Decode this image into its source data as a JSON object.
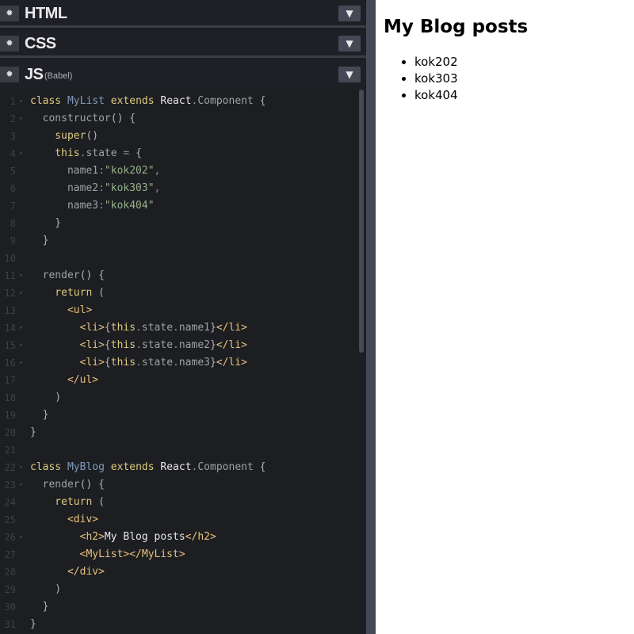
{
  "panels": {
    "html": {
      "title": "HTML",
      "sub": ""
    },
    "css": {
      "title": "CSS",
      "sub": ""
    },
    "js": {
      "title": "JS",
      "sub": "(Babel)"
    }
  },
  "icons": {
    "gear": "gear-icon",
    "chevron": "chevron-down-icon"
  },
  "colors": {
    "editor_bg": "#1d1e22",
    "header_bg": "#1f2026",
    "resizer": "#444857",
    "keyword": "#ddca7e",
    "class_name": "#809bbd",
    "string": "#96b38a",
    "tag": "#e6c07b"
  },
  "code": [
    {
      "n": "1",
      "fold": true,
      "tokens": [
        [
          "kw",
          "class "
        ],
        [
          "cls",
          "MyList "
        ],
        [
          "kw",
          "extends "
        ],
        [
          "txt",
          "React"
        ],
        [
          "pun",
          "."
        ],
        [
          "pl",
          "Component "
        ],
        [
          "br",
          "{"
        ]
      ]
    },
    {
      "n": "2",
      "fold": true,
      "tokens": [
        [
          "pl",
          "  constructor"
        ],
        [
          "br",
          "() {"
        ]
      ]
    },
    {
      "n": "3",
      "fold": false,
      "tokens": [
        [
          "kw",
          "    super"
        ],
        [
          "br",
          "()"
        ]
      ]
    },
    {
      "n": "4",
      "fold": true,
      "tokens": [
        [
          "kw",
          "    this"
        ],
        [
          "pun",
          "."
        ],
        [
          "pl",
          "state "
        ],
        [
          "pun",
          "= "
        ],
        [
          "br",
          "{"
        ]
      ]
    },
    {
      "n": "5",
      "fold": false,
      "tokens": [
        [
          "pl",
          "      name1"
        ],
        [
          "pun",
          ":"
        ],
        [
          "str",
          "\"kok202\""
        ],
        [
          "pun",
          ","
        ]
      ]
    },
    {
      "n": "6",
      "fold": false,
      "tokens": [
        [
          "pl",
          "      name2"
        ],
        [
          "pun",
          ":"
        ],
        [
          "str",
          "\"kok303\""
        ],
        [
          "pun",
          ","
        ]
      ]
    },
    {
      "n": "7",
      "fold": false,
      "tokens": [
        [
          "pl",
          "      name3"
        ],
        [
          "pun",
          ":"
        ],
        [
          "str",
          "\"kok404\""
        ]
      ]
    },
    {
      "n": "8",
      "fold": false,
      "tokens": [
        [
          "br",
          "    }"
        ]
      ]
    },
    {
      "n": "9",
      "fold": false,
      "tokens": [
        [
          "br",
          "  }"
        ]
      ]
    },
    {
      "n": "10",
      "fold": false,
      "tokens": []
    },
    {
      "n": "11",
      "fold": true,
      "tokens": [
        [
          "pl",
          "  render"
        ],
        [
          "br",
          "() {"
        ]
      ]
    },
    {
      "n": "12",
      "fold": true,
      "tokens": [
        [
          "kw",
          "    return "
        ],
        [
          "br",
          "("
        ]
      ]
    },
    {
      "n": "13",
      "fold": false,
      "tokens": [
        [
          "tag",
          "      <ul>"
        ]
      ]
    },
    {
      "n": "14",
      "fold": true,
      "tokens": [
        [
          "tag",
          "        <li>"
        ],
        [
          "br",
          "{"
        ],
        [
          "kw",
          "this"
        ],
        [
          "pun",
          "."
        ],
        [
          "pl",
          "state"
        ],
        [
          "pun",
          "."
        ],
        [
          "pl",
          "name1"
        ],
        [
          "br",
          "}"
        ],
        [
          "tag",
          "</li>"
        ]
      ]
    },
    {
      "n": "15",
      "fold": true,
      "tokens": [
        [
          "tag",
          "        <li>"
        ],
        [
          "br",
          "{"
        ],
        [
          "kw",
          "this"
        ],
        [
          "pun",
          "."
        ],
        [
          "pl",
          "state"
        ],
        [
          "pun",
          "."
        ],
        [
          "pl",
          "name2"
        ],
        [
          "br",
          "}"
        ],
        [
          "tag",
          "</li>"
        ]
      ]
    },
    {
      "n": "16",
      "fold": true,
      "tokens": [
        [
          "tag",
          "        <li>"
        ],
        [
          "br",
          "{"
        ],
        [
          "kw",
          "this"
        ],
        [
          "pun",
          "."
        ],
        [
          "pl",
          "state"
        ],
        [
          "pun",
          "."
        ],
        [
          "pl",
          "name3"
        ],
        [
          "br",
          "}"
        ],
        [
          "tag",
          "</li>"
        ]
      ]
    },
    {
      "n": "17",
      "fold": false,
      "tokens": [
        [
          "tag",
          "      </ul>"
        ]
      ]
    },
    {
      "n": "18",
      "fold": false,
      "tokens": [
        [
          "br",
          "    )"
        ]
      ]
    },
    {
      "n": "19",
      "fold": false,
      "tokens": [
        [
          "br",
          "  }"
        ]
      ]
    },
    {
      "n": "20",
      "fold": false,
      "tokens": [
        [
          "br",
          "}"
        ]
      ]
    },
    {
      "n": "21",
      "fold": false,
      "tokens": []
    },
    {
      "n": "22",
      "fold": true,
      "tokens": [
        [
          "kw",
          "class "
        ],
        [
          "cls",
          "MyBlog "
        ],
        [
          "kw",
          "extends "
        ],
        [
          "txt",
          "React"
        ],
        [
          "pun",
          "."
        ],
        [
          "pl",
          "Component "
        ],
        [
          "br",
          "{"
        ]
      ]
    },
    {
      "n": "23",
      "fold": true,
      "tokens": [
        [
          "pl",
          "  render"
        ],
        [
          "br",
          "() {"
        ]
      ]
    },
    {
      "n": "24",
      "fold": false,
      "tokens": [
        [
          "kw",
          "    return "
        ],
        [
          "br",
          "("
        ]
      ]
    },
    {
      "n": "25",
      "fold": false,
      "tokens": [
        [
          "tag",
          "      <div>"
        ]
      ]
    },
    {
      "n": "26",
      "fold": true,
      "tokens": [
        [
          "tag",
          "        <h2>"
        ],
        [
          "txt",
          "My Blog posts"
        ],
        [
          "tag",
          "</h2>"
        ]
      ]
    },
    {
      "n": "27",
      "fold": false,
      "tokens": [
        [
          "tag",
          "        <MyList></MyList>"
        ]
      ]
    },
    {
      "n": "28",
      "fold": false,
      "tokens": [
        [
          "tag",
          "      </div>"
        ]
      ]
    },
    {
      "n": "29",
      "fold": false,
      "tokens": [
        [
          "br",
          "    )"
        ]
      ]
    },
    {
      "n": "30",
      "fold": false,
      "tokens": [
        [
          "br",
          "  }"
        ]
      ]
    },
    {
      "n": "31",
      "fold": false,
      "tokens": [
        [
          "br",
          "}"
        ]
      ]
    }
  ],
  "preview": {
    "title": "My Blog posts",
    "items": [
      "kok202",
      "kok303",
      "kok404"
    ]
  }
}
